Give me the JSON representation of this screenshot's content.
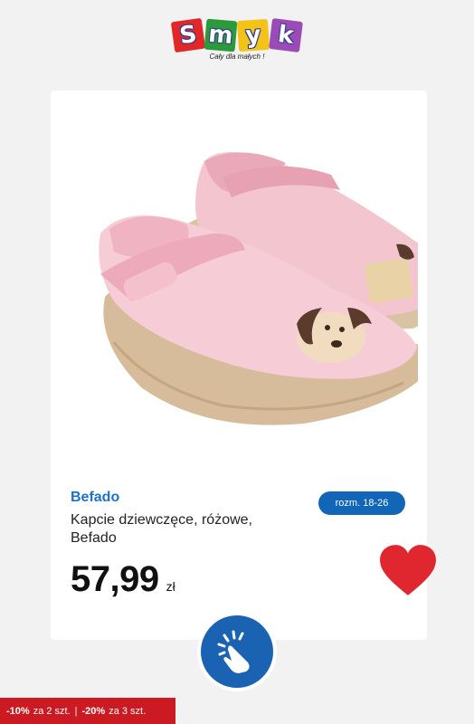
{
  "logo": {
    "letters": [
      "S",
      "m",
      "y",
      "k"
    ],
    "letter_colors": [
      "#e02828",
      "#2b9a3b",
      "#f3c318",
      "#9a4bb8"
    ],
    "tagline": "Cały dla małych !"
  },
  "product": {
    "image_alt": "pink-children-slippers-with-dog-applique",
    "brand": "Befado",
    "name": "Kapcie dziewczęce, różowe, Befado",
    "size_badge": "rozm. 18-26",
    "price": "57,99",
    "currency": "zł"
  },
  "icons": {
    "favorite": "heart-icon",
    "tap": "hand-tap-icon"
  },
  "promo": {
    "first_discount": "-10%",
    "first_condition": "za 2 szt.",
    "separator": "|",
    "second_discount": "-20%",
    "second_condition": "za 3 szt."
  },
  "colors": {
    "accent_blue": "#1266b8",
    "heart_red": "#e0262e",
    "promo_red": "#cc1a22"
  }
}
